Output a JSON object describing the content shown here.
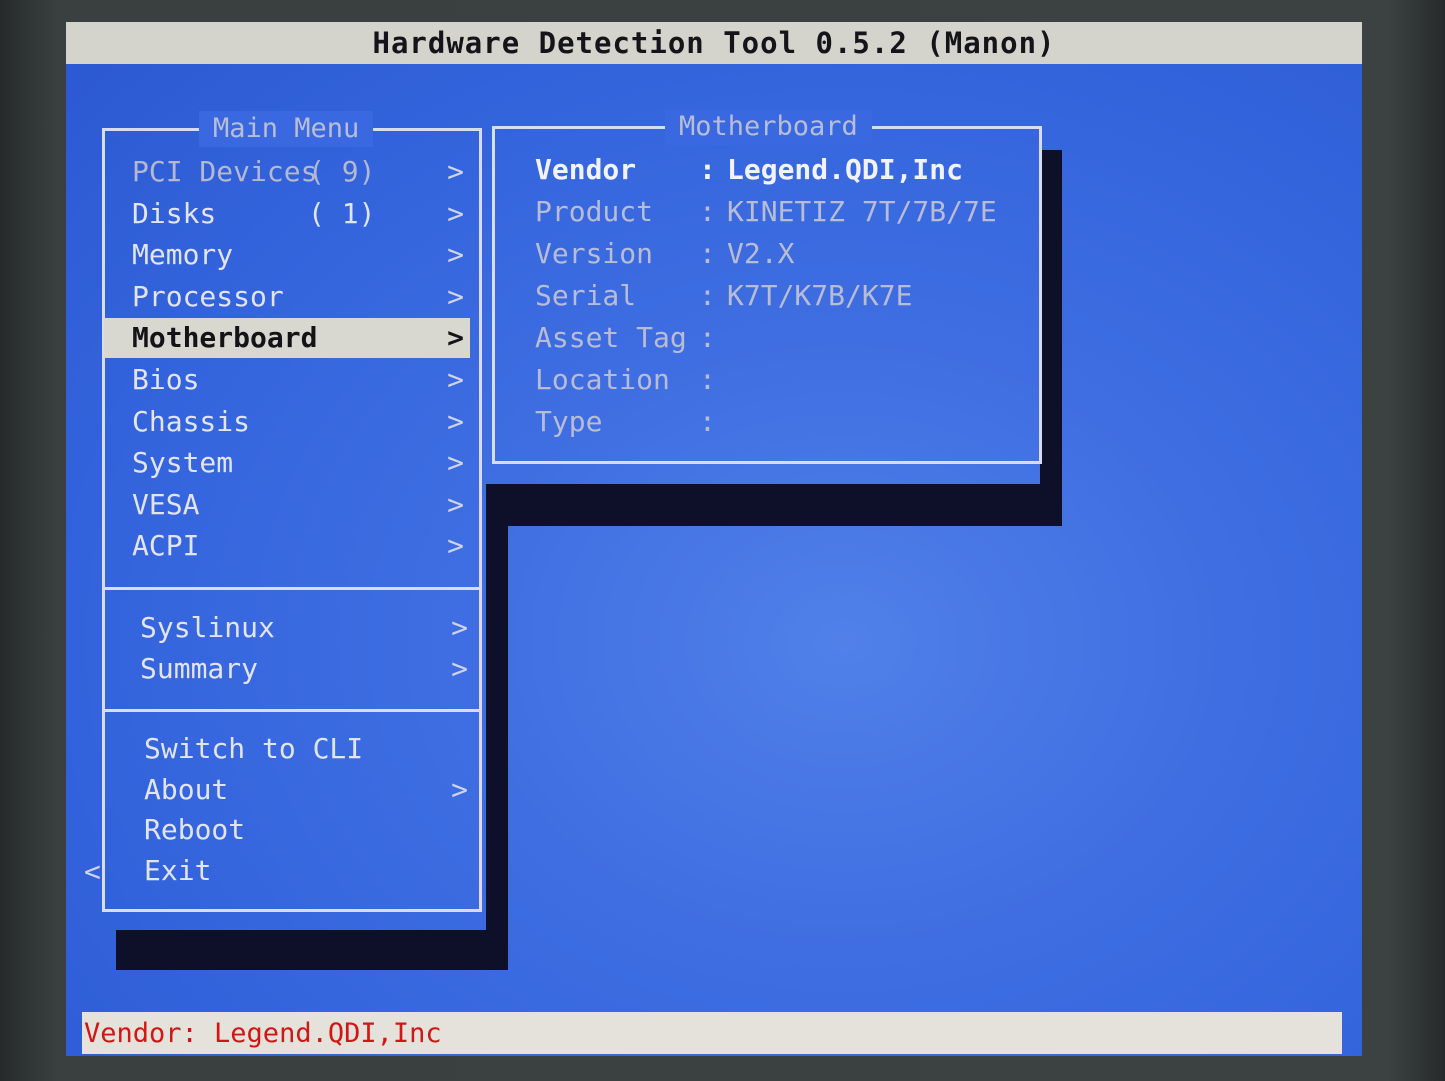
{
  "window": {
    "title": "Hardware Detection Tool 0.5.2 (Manon)"
  },
  "main_menu": {
    "title": "Main Menu",
    "items": [
      {
        "label": "PCI Devices",
        "count": "( 9)",
        "arrow": ">"
      },
      {
        "label": "Disks",
        "count": "( 1)",
        "arrow": ">"
      },
      {
        "label": "Memory",
        "arrow": ">"
      },
      {
        "label": "Processor",
        "arrow": ">"
      },
      {
        "label": "Motherboard",
        "arrow": ">",
        "selected": true
      },
      {
        "label": "Bios",
        "arrow": ">"
      },
      {
        "label": "Chassis",
        "arrow": ">"
      },
      {
        "label": "System",
        "arrow": ">"
      },
      {
        "label": "VESA",
        "arrow": ">"
      },
      {
        "label": "ACPI",
        "arrow": ">"
      }
    ],
    "group2": [
      {
        "label": "Syslinux",
        "arrow": ">"
      },
      {
        "label": "Summary",
        "arrow": ">"
      }
    ],
    "group3": [
      {
        "label": "Switch to CLI"
      },
      {
        "label": "About",
        "arrow": ">"
      },
      {
        "label": "Reboot"
      },
      {
        "label": "Exit",
        "back_arrow": "<"
      }
    ]
  },
  "motherboard_panel": {
    "title": "Motherboard",
    "fields": [
      {
        "name": "Vendor",
        "value": "Legend.QDI,Inc"
      },
      {
        "name": "Product",
        "value": "KINETIZ 7T/7B/7E"
      },
      {
        "name": "Version",
        "value": "V2.X"
      },
      {
        "name": "Serial",
        "value": "K7T/K7B/K7E"
      },
      {
        "name": "Asset Tag",
        "value": ""
      },
      {
        "name": "Location",
        "value": ""
      },
      {
        "name": "Type",
        "value": ""
      }
    ]
  },
  "status_bar": {
    "text": "Vendor: Legend.QDI,Inc"
  },
  "colors": {
    "screen_bg": "#3363dc",
    "title_bar_bg": "#d4d4cc",
    "selection_bg": "#d8d8d0",
    "status_text": "#d01616",
    "shadow": "#0d1028"
  }
}
